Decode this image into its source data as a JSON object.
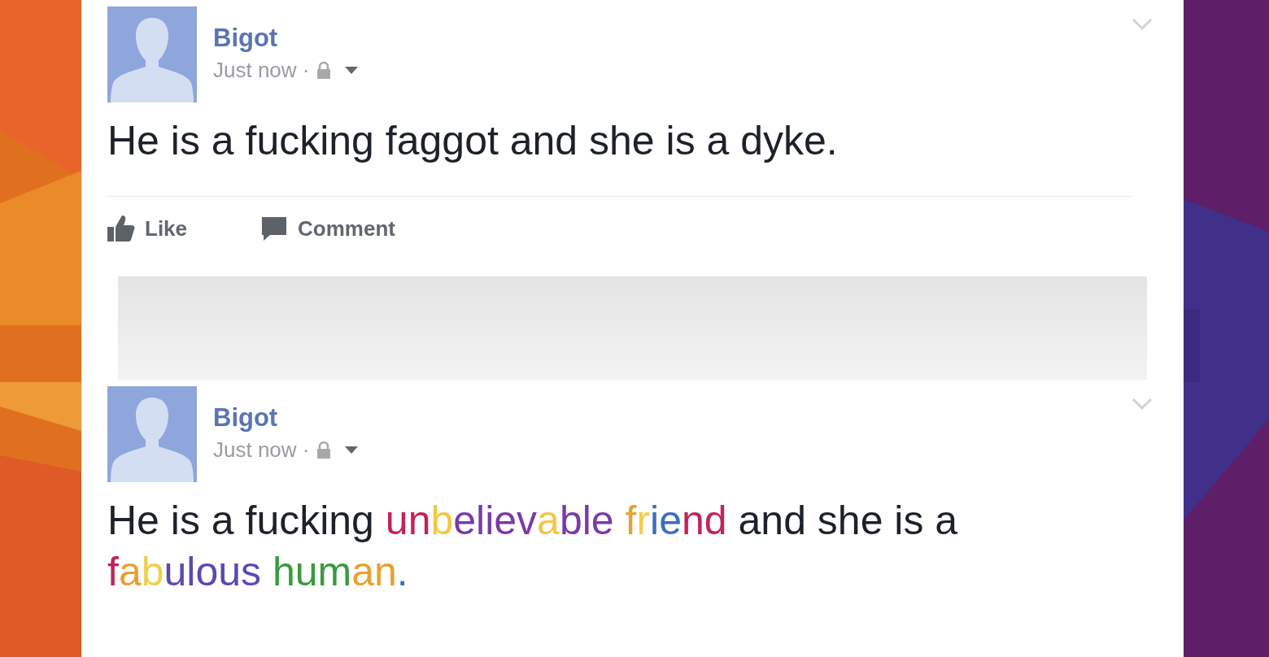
{
  "posts": [
    {
      "author": "Bigot",
      "time": "Just now ·",
      "body": [
        {
          "text": "He is a fucking faggot and she is a dyke."
        }
      ],
      "actions": [
        "Like",
        "Comment"
      ]
    },
    {
      "author": "Bigot",
      "time": "Just now ·",
      "body": [
        {
          "text": "He is a fucking "
        },
        {
          "text": "un",
          "color": "#c0245a"
        },
        {
          "text": "b",
          "color": "#f2c744"
        },
        {
          "text": "eliev",
          "color": "#7a3aa8"
        },
        {
          "text": "a",
          "color": "#f2c744"
        },
        {
          "text": "ble",
          "color": "#7a3aa8"
        },
        {
          "text": " f",
          "color": "#e8a030"
        },
        {
          "text": "r",
          "color": "#f0d050"
        },
        {
          "text": "ie",
          "color": "#3a6ec0"
        },
        {
          "text": "nd",
          "color": "#c0245a"
        },
        {
          "text": " and she is a "
        },
        {
          "text": "f",
          "color": "#c0245a"
        },
        {
          "text": "a",
          "color": "#e8a030"
        },
        {
          "text": "b",
          "color": "#f0d050"
        },
        {
          "text": "ulous",
          "color": "#5a4ab0"
        },
        {
          "text": " hum",
          "color": "#3a9a40"
        },
        {
          "text": "an",
          "color": "#e8a030"
        },
        {
          "text": ".",
          "color": "#3a6ec0"
        }
      ]
    }
  ]
}
